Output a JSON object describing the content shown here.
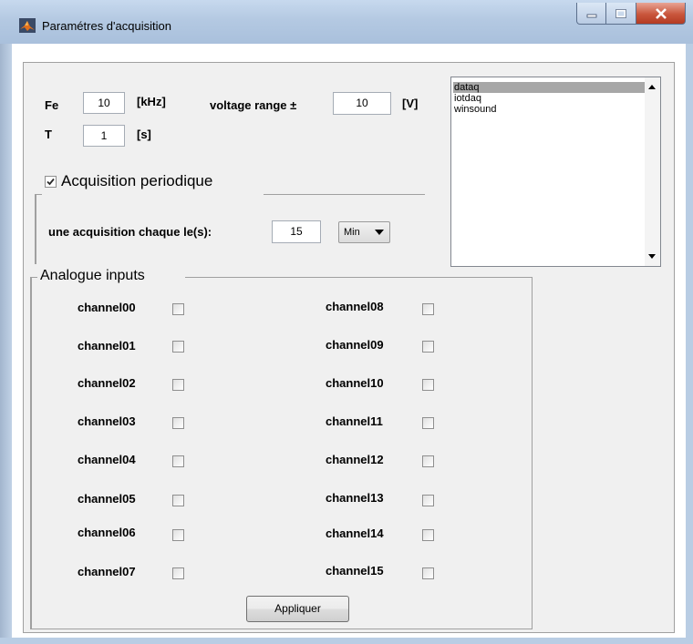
{
  "window": {
    "title": "Paramétres d'acquisition",
    "minimize_icon": "minimize-icon",
    "maximize_icon": "maximize-icon",
    "close_icon": "close-icon"
  },
  "params": {
    "fe_label": "Fe",
    "fe_value": "10",
    "fe_unit": "[kHz]",
    "voltage_label": "voltage range ±",
    "voltage_value": "10",
    "voltage_unit": "[V]",
    "t_label": "T",
    "t_value": "1",
    "t_unit": "[s]"
  },
  "periodic": {
    "checkbox_label": "Acquisition periodique",
    "checked": true,
    "interval_label": "une acquisition chaque le(s):",
    "interval_value": "15",
    "unit_selected": "Min"
  },
  "device_list": {
    "items": [
      "dataq",
      "iotdaq",
      "winsound"
    ],
    "selected": "dataq"
  },
  "inputs": {
    "group_title": "Analogue inputs",
    "channels_left": [
      "channel00",
      "channel01",
      "channel02",
      "channel03",
      "channel04",
      "channel05",
      "channel06",
      "channel07"
    ],
    "channels_right": [
      "channel08",
      "channel09",
      "channel10",
      "channel11",
      "channel12",
      "channel13",
      "channel14",
      "channel15"
    ]
  },
  "apply_button": "Appliquer",
  "colors": {
    "titlebar": "#b4c9e2",
    "panel": "#f0f0f0",
    "selection": "#a7a7a7",
    "close_button": "#c9563c"
  }
}
